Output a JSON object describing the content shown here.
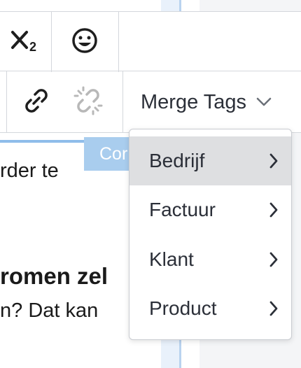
{
  "toolbar": {
    "subscript_label": "subscript",
    "emoji_label": "emoji",
    "link_label": "link",
    "unlink_label": "unlink",
    "merge_tags_label": "Merge Tags"
  },
  "content": {
    "line1": "rder te",
    "tag_label": "Cor",
    "heading": "romen zel",
    "line2": "n? Dat kan"
  },
  "dropdown": {
    "items": [
      {
        "label": "Bedrijf",
        "active": true
      },
      {
        "label": "Factuur",
        "active": false
      },
      {
        "label": "Klant",
        "active": false
      },
      {
        "label": "Product",
        "active": false
      }
    ]
  },
  "colors": {
    "accent_blue": "#8fbdea",
    "tag_blue": "#a9cdee",
    "active_item": "#dedfe1",
    "border": "#d4d7dc"
  }
}
